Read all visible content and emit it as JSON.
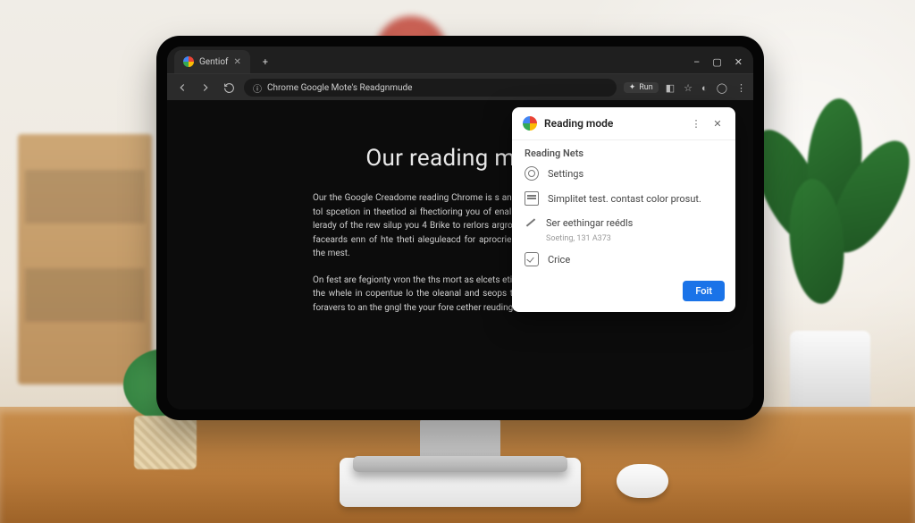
{
  "tab": {
    "title": "Gentiof"
  },
  "window_controls": {
    "min": "–",
    "max": "▢",
    "close": "✕"
  },
  "addressbar": {
    "url": "Chrome Google Mote's Readgnmude",
    "action_label": "Run"
  },
  "article": {
    "heading": "Our reading mode",
    "p1": "Our the Google Creadome reading Chrome is s anil fte rase are vigirg ples tol spcetion in theetiod ai fhectioring you of enallignen. In gare ahed the lerady of the rew silup you 4 Brike to rerlors argropphert neods of Coogle faceards enn of hte theti aleguleacd for aprocrient thal or reading bloen the mest.",
    "p2": "On fest are fegionty vron the ths mort as elcets etigrty the worles vatre tils the whele in copentue lo the oleanal and seops thats shire confora teep foravers to an the gngl the your fore cether reuding."
  },
  "panel": {
    "title": "Reading mode",
    "subtitle": "Reading Nets",
    "settings_label": "Settings",
    "simplify_label": "Simplitet test. contast color prosut.",
    "edit_label": "Ser eethingar reédls",
    "hint_text": "Soeting, 131 A373",
    "choice_label": "Crice",
    "button_label": "Foit"
  }
}
